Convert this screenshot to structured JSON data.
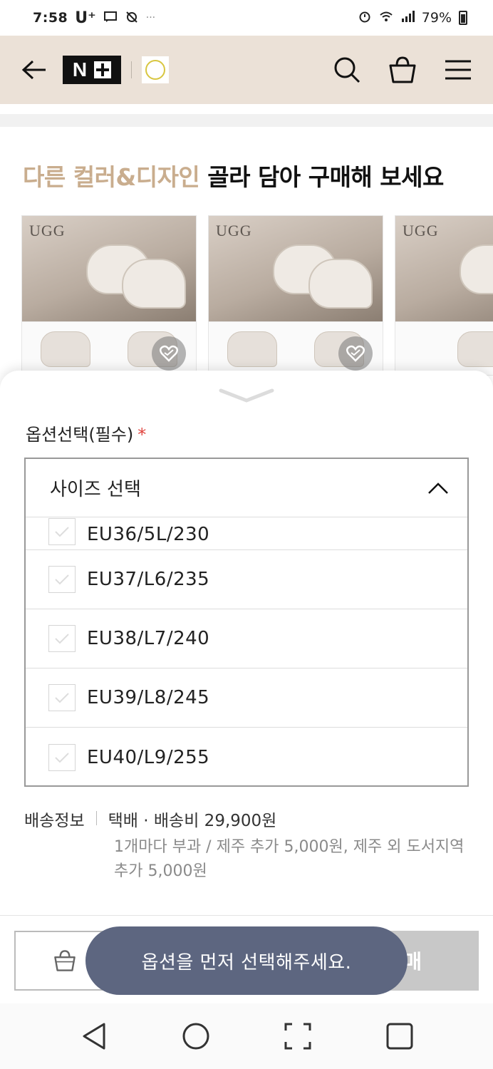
{
  "status_bar": {
    "time": "7:58",
    "carrier": "U⁺",
    "battery": "79%"
  },
  "header": {
    "logo_text": "N",
    "icons": [
      "back-arrow-icon",
      "search-icon",
      "shopping-bag-icon",
      "menu-icon"
    ]
  },
  "section": {
    "title_accent": "다른 컬러&디자인",
    "title_rest": " 골라 담아 구매해 보세요"
  },
  "products": [
    {
      "brand": "UGG"
    },
    {
      "brand": "UGG"
    },
    {
      "brand": "UGG"
    }
  ],
  "option": {
    "label": "옵션선택(필수)",
    "required_mark": "*",
    "select_label": "사이즈 선택",
    "items": [
      {
        "label": "EU36/5L/230"
      },
      {
        "label": "EU37/L6/235"
      },
      {
        "label": "EU38/L7/240"
      },
      {
        "label": "EU39/L8/245"
      },
      {
        "label": "EU40/L9/255"
      }
    ]
  },
  "shipping": {
    "key": "배송정보",
    "value": "택배 · 배송비 29,900원",
    "description": "1개마다 부과 / 제주 추가 5,000원, 제주 외 도서지역 추가 5,000원"
  },
  "actions": {
    "buy_label": "매"
  },
  "toast": {
    "message": "옵션을 먼저 선택해주세요."
  },
  "colors": {
    "header_bg": "#ebe1d7",
    "accent": "#c9ad8e",
    "toast_bg": "#5d6680",
    "required": "#e0443e"
  }
}
